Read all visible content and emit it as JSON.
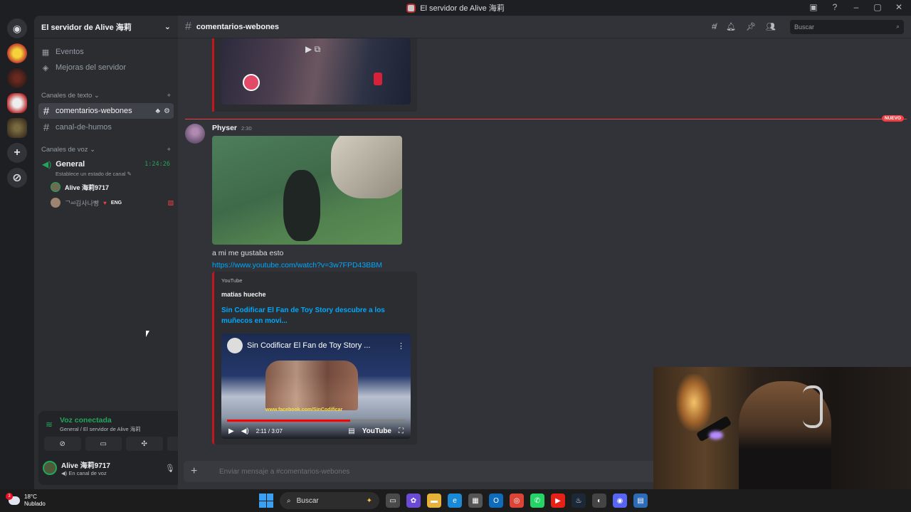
{
  "window": {
    "title": "El servidor de Alive 海莉"
  },
  "server": {
    "name": "El servidor de Alive 海莉",
    "menu_items": [
      {
        "label": "Eventos",
        "icon": "calendar-icon"
      },
      {
        "label": "Mejoras del servidor",
        "icon": "boost-icon"
      }
    ],
    "text_category": "Canales de texto",
    "text_channels": [
      {
        "name": "comentarios-webones",
        "active": true
      },
      {
        "name": "canal-de-humos",
        "active": false
      }
    ],
    "voice_category": "Canales de voz",
    "voice_channel": {
      "name": "General",
      "timer": "1:24:26",
      "status": "Establece un estado de canal",
      "users": [
        {
          "name": "Alive 海莉9717"
        },
        {
          "name": "ᄀᅠᵃᵈ김사나빵",
          "tag": "ENG"
        }
      ]
    }
  },
  "voice_panel": {
    "title": "Voz conectada",
    "subtitle": "General / El servidor de Alive 海莉"
  },
  "user": {
    "name": "Alive 海莉9717",
    "status": "En canal de voz"
  },
  "chat": {
    "channel": "comentarios-webones",
    "search_placeholder": "Buscar",
    "new_badge": "NUEVO",
    "message": {
      "author": "Physer",
      "time": "2:30",
      "text": "a mi me gustaba esto",
      "link": "https://www.youtube.com/watch?v=3w7FPD43BBM",
      "embed": {
        "provider": "YouTube",
        "author": "matias hueche",
        "title": "Sin Codificar   El Fan de Toy Story descubre a los muñecos en movi...",
        "video_title": "Sin Codificar El Fan de Toy Story ...",
        "overlay_text": "www.facebook.com/SinCodificar",
        "time": "2:11 / 3:07",
        "progress": 0.69,
        "logo": "YouTube"
      }
    },
    "composer_placeholder": "Enviar mensaje a #comentarios-webones"
  },
  "taskbar": {
    "temp": "18°C",
    "weather": "Nublado",
    "badge": "3",
    "search_placeholder": "Buscar"
  },
  "colors": {
    "accent_green": "#23a55a",
    "link": "#00a8fc",
    "embed_bar": "#c4161c",
    "new_red": "#f23f43"
  }
}
